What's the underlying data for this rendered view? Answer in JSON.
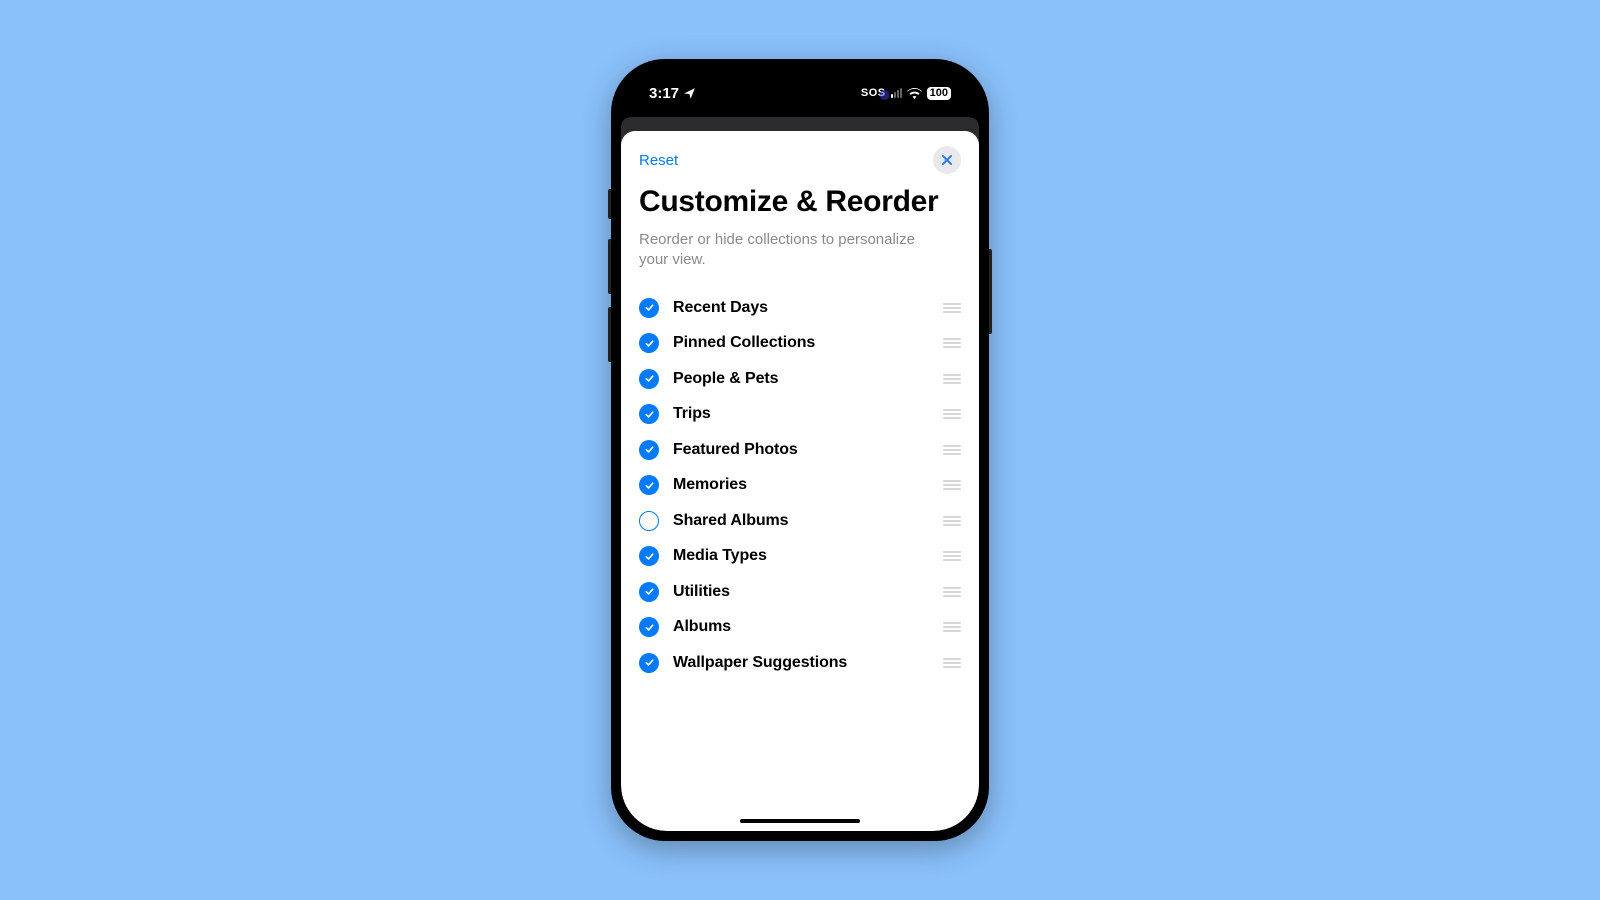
{
  "status_bar": {
    "time": "3:17",
    "sos": "SOS",
    "battery": "100"
  },
  "sheet": {
    "reset_label": "Reset",
    "title": "Customize & Reorder",
    "subtitle": "Reorder or hide collections to personalize your view."
  },
  "collections": [
    {
      "label": "Recent Days",
      "checked": true
    },
    {
      "label": "Pinned Collections",
      "checked": true
    },
    {
      "label": "People & Pets",
      "checked": true
    },
    {
      "label": "Trips",
      "checked": true
    },
    {
      "label": "Featured Photos",
      "checked": true
    },
    {
      "label": "Memories",
      "checked": true
    },
    {
      "label": "Shared Albums",
      "checked": false
    },
    {
      "label": "Media Types",
      "checked": true
    },
    {
      "label": "Utilities",
      "checked": true
    },
    {
      "label": "Albums",
      "checked": true
    },
    {
      "label": "Wallpaper Suggestions",
      "checked": true
    }
  ]
}
